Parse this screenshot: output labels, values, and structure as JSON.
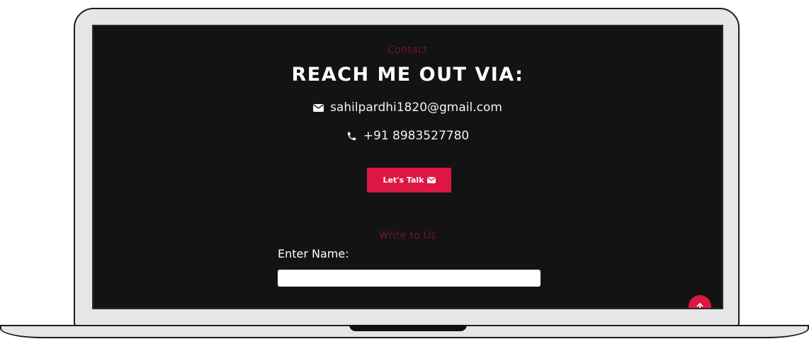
{
  "contact": {
    "eyebrow": "Contact",
    "heading": "REACH ME OUT VIA:",
    "email": "sahilpardhi1820@gmail.com",
    "phone": "+91 8983527780",
    "talk_button_label": "Let's Talk"
  },
  "form": {
    "eyebrow": "Write to Us",
    "name_label": "Enter Name:",
    "name_value": "",
    "name_placeholder": ""
  },
  "icons": {
    "email": "envelope-icon",
    "phone": "phone-icon",
    "talk_button": "envelope-icon",
    "scroll_top": "arrow-up-icon"
  },
  "colors": {
    "accent": "#dc1743",
    "screen_background": "#131314",
    "text": "#ffffff",
    "device_frame": "#e6e6e6"
  }
}
